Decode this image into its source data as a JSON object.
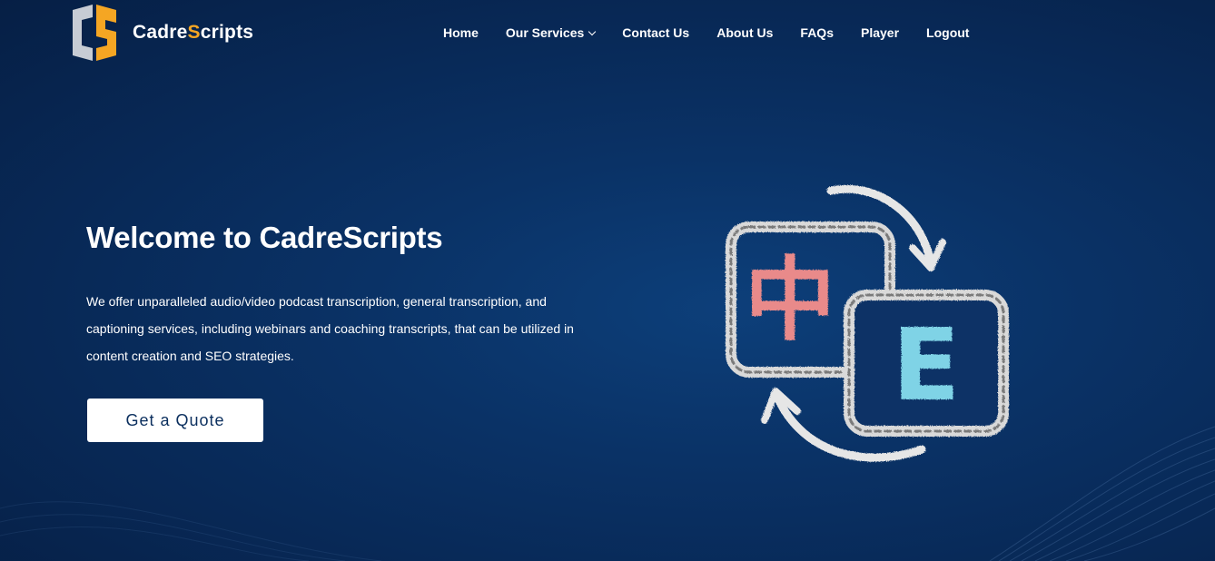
{
  "brand": {
    "name_prefix": "Cadre",
    "name_accent": "S",
    "name_suffix": "cripts",
    "accent_color": "#f5a623",
    "logo_letters": "CS"
  },
  "nav": {
    "items": [
      {
        "label": "Home"
      },
      {
        "label": "Our Services",
        "has_dropdown": true
      },
      {
        "label": "Contact Us"
      },
      {
        "label": "About Us"
      },
      {
        "label": "FAQs"
      },
      {
        "label": "Player"
      },
      {
        "label": "Logout"
      }
    ]
  },
  "hero": {
    "title": "Welcome to CadreScripts",
    "description": "We offer unparalleled audio/video podcast transcription, general transcription, and captioning services, including webinars and coaching transcripts, that can be utilized in content creation and SEO strategies.",
    "cta_label": "Get a Quote"
  },
  "illustration": {
    "left_glyph": "中",
    "right_glyph": "E",
    "left_glyph_color": "#e98a8a",
    "right_glyph_color": "#7fd3e6"
  },
  "theme": {
    "background": "#0a3266",
    "text": "#ffffff",
    "button_text": "#0b2f5e"
  }
}
